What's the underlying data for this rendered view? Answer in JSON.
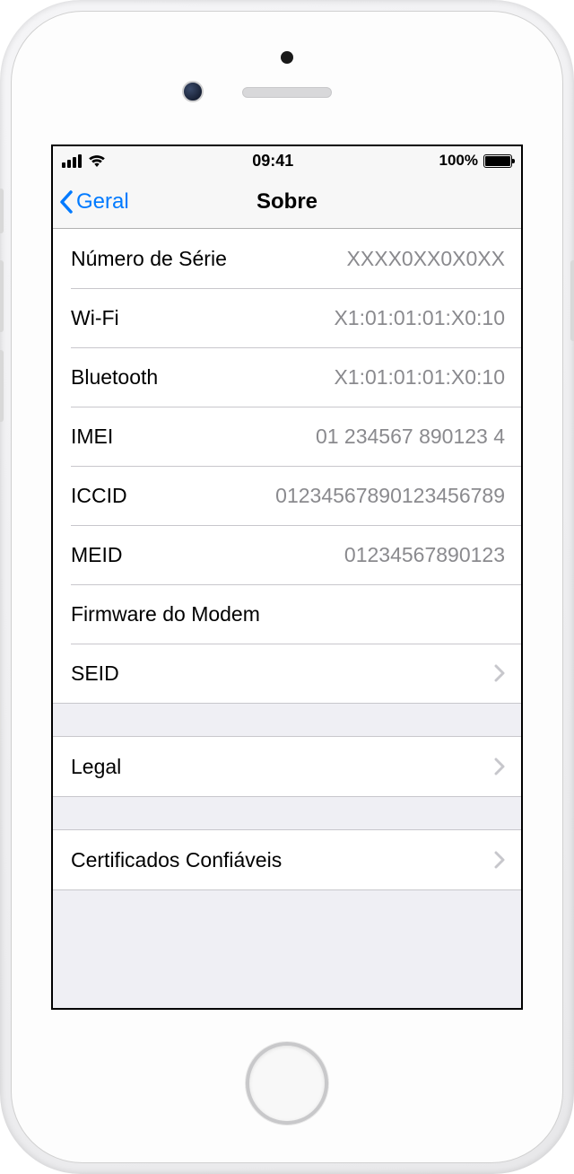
{
  "statusBar": {
    "time": "09:41",
    "batteryPercent": "100%"
  },
  "nav": {
    "back": "Geral",
    "title": "Sobre"
  },
  "sections": [
    {
      "rows": [
        {
          "label": "Número de Série",
          "value": "XXXX0XX0X0XX",
          "disclosure": false
        },
        {
          "label": "Wi-Fi",
          "value": "X1:01:01:01:X0:10",
          "disclosure": false
        },
        {
          "label": "Bluetooth",
          "value": "X1:01:01:01:X0:10",
          "disclosure": false
        },
        {
          "label": "IMEI",
          "value": "01 234567 890123 4",
          "disclosure": false
        },
        {
          "label": "ICCID",
          "value": "01234567890123456789",
          "disclosure": false
        },
        {
          "label": "MEID",
          "value": "01234567890123",
          "disclosure": false
        },
        {
          "label": "Firmware do Modem",
          "value": "",
          "disclosure": false
        },
        {
          "label": "SEID",
          "value": "",
          "disclosure": true
        }
      ]
    },
    {
      "rows": [
        {
          "label": "Legal",
          "value": "",
          "disclosure": true
        }
      ]
    },
    {
      "rows": [
        {
          "label": "Certificados Confiáveis",
          "value": "",
          "disclosure": true
        }
      ]
    }
  ]
}
